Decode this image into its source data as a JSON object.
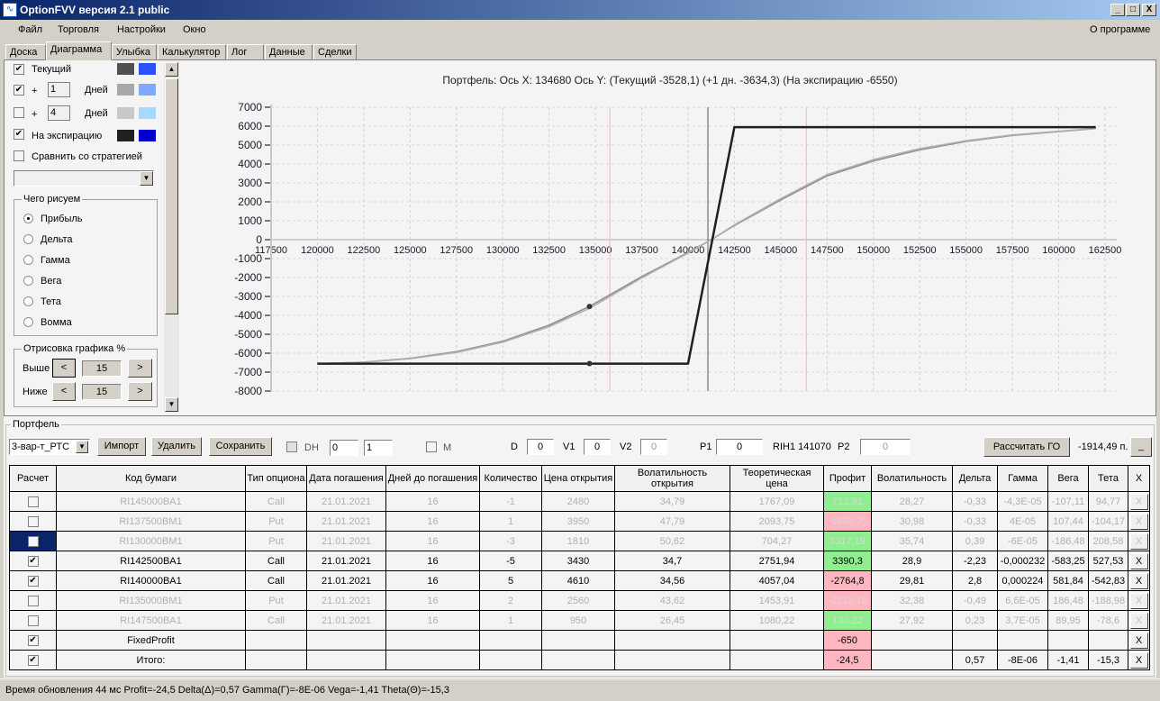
{
  "window": {
    "title": "OptionFVV версия 2.1 public",
    "minimize": "_",
    "maximize": "□",
    "close": "X"
  },
  "menu": {
    "items": [
      "Файл",
      "Торговля",
      "Настройки",
      "Окно"
    ],
    "about": "О программе"
  },
  "tabs": [
    "Доска",
    "Диаграмма",
    "Улыбка",
    "Калькулятор",
    "Лог",
    "Данные",
    "Сделки"
  ],
  "active_tab": "Диаграмма",
  "left_panel": {
    "current": {
      "label": "Текущий",
      "checked": true,
      "color1": "#505050",
      "color2": "#2a50ff"
    },
    "plus1": {
      "plus": "+",
      "days": "1",
      "label": "Дней",
      "checked": true,
      "color1": "#a8a8a8",
      "color2": "#80a8ff"
    },
    "plus4": {
      "plus": "+",
      "days": "4",
      "label": "Дней",
      "checked": false,
      "color1": "#c8c8c8",
      "color2": "#a8d8ff"
    },
    "expiration": {
      "label": "На экспирацию",
      "checked": true,
      "color1": "#202020",
      "color2": "#0000c8"
    },
    "compare": {
      "label": "Сравнить со стратегией",
      "checked": false
    },
    "compare_select": "",
    "draw_group": {
      "title": "Чего рисуем",
      "options": [
        "Прибыль",
        "Дельта",
        "Гамма",
        "Вега",
        "Тета",
        "Вомма"
      ],
      "selected": "Прибыль"
    },
    "range_group": {
      "title": "Отрисовка графика %",
      "above_label": "Выше",
      "above_value": "15",
      "below_label": "Ниже",
      "below_value": "15",
      "dec": "<",
      "inc": ">"
    }
  },
  "chart_header": "Портфель: Ось X: 134680 Ось Y:  (Текущий -3528,1)  (+1 дн. -3634,3)  (На экспирацию -6550)",
  "chart_data": {
    "type": "line",
    "title": "Портфель: Ось X: 134680 Ось Y:  (Текущий -3528,1)  (+1 дн. -3634,3)  (На экспирацию -6550)",
    "xlim": [
      117500,
      162500
    ],
    "ylim": [
      -8000,
      7000
    ],
    "xticks": [
      117500,
      120000,
      122500,
      125000,
      127500,
      130000,
      132500,
      135000,
      137500,
      140000,
      142500,
      145000,
      147500,
      150000,
      152500,
      155000,
      157500,
      160000,
      162500
    ],
    "yticks": [
      7000,
      6000,
      5000,
      4000,
      3000,
      2000,
      1000,
      0,
      -1000,
      -2000,
      -3000,
      -4000,
      -5000,
      -6000,
      -7000,
      -8000
    ],
    "grid": true,
    "series": [
      {
        "name": "Текущий",
        "color": "#909090",
        "points": [
          [
            120000,
            -6550
          ],
          [
            122500,
            -6470
          ],
          [
            125000,
            -6270
          ],
          [
            127500,
            -5920
          ],
          [
            130000,
            -5365
          ],
          [
            132500,
            -4520
          ],
          [
            134680,
            -3528
          ],
          [
            137500,
            -1950
          ],
          [
            140000,
            -680
          ],
          [
            141250,
            0
          ],
          [
            142500,
            750
          ],
          [
            145000,
            2100
          ],
          [
            147500,
            3370
          ],
          [
            150000,
            4160
          ],
          [
            152500,
            4750
          ],
          [
            155000,
            5190
          ],
          [
            157500,
            5510
          ],
          [
            160000,
            5710
          ],
          [
            162000,
            5870
          ]
        ]
      },
      {
        "name": "+1 дн.",
        "color": "#b0b0b0",
        "points": [
          [
            120000,
            -6550
          ],
          [
            122500,
            -6480
          ],
          [
            125000,
            -6290
          ],
          [
            127500,
            -5960
          ],
          [
            130000,
            -5420
          ],
          [
            132500,
            -4600
          ],
          [
            134680,
            -3634
          ],
          [
            137500,
            -2020
          ],
          [
            140000,
            -710
          ],
          [
            141250,
            0
          ],
          [
            142500,
            780
          ],
          [
            145000,
            2170
          ],
          [
            147500,
            3440
          ],
          [
            150000,
            4230
          ],
          [
            152500,
            4810
          ],
          [
            155000,
            5230
          ],
          [
            157500,
            5540
          ],
          [
            160000,
            5730
          ],
          [
            162000,
            5880
          ]
        ]
      },
      {
        "name": "На экспирацию",
        "color": "#202020",
        "points": [
          [
            120000,
            -6550
          ],
          [
            140000,
            -6550
          ],
          [
            142500,
            5950
          ],
          [
            162000,
            5950
          ]
        ]
      }
    ],
    "markers": [
      {
        "x": 134680,
        "y": -3528.1
      },
      {
        "x": 134680,
        "y": -6550
      }
    ],
    "cursor_x": 134680,
    "current_price": 141070,
    "reference_lines": [
      135780,
      146380
    ]
  },
  "portfolio": {
    "title": "Портфель",
    "strategy": "3-вар-т_РТС",
    "import": "Импорт",
    "delete": "Удалить",
    "save": "Сохранить",
    "dh_label": "DH",
    "dh_spin1": "0",
    "dh_spin2": "1",
    "m_label": "M",
    "d_label": "D",
    "d_value": "0",
    "v1_label": "V1",
    "v1_value": "0",
    "v2_label": "V2",
    "v2_value": "0",
    "p1_label": "P1",
    "p1_value": "0",
    "instrument": "RIH1 141070",
    "p2_label": "P2",
    "p2_value": "0",
    "calc_go": "Рассчитать ГО",
    "go_value": "-1914,49 п.",
    "go_button": "_",
    "columns": [
      "Расчет",
      "Код бумаги",
      "Тип опциона",
      "Дата погашения",
      "Дней до погашения",
      "Количество",
      "Цена открытия",
      "Волатильность открытия",
      "Теоретическая цена",
      "Профит",
      "Волатильность",
      "Дельта",
      "Гамма",
      "Вега",
      "Тета",
      "X"
    ],
    "rows": [
      {
        "checked": false,
        "enabled": false,
        "cells": [
          "RI145000BA1",
          "Call",
          "21.01.2021",
          "16",
          "-1",
          "2480",
          "34,79",
          "1767,09",
          "712,91",
          "28,27",
          "-0,33",
          "-4,3E-05",
          "-107,11",
          "94,77"
        ],
        "profit_sign": "pos"
      },
      {
        "checked": false,
        "enabled": false,
        "cells": [
          "RI137500BM1",
          "Put",
          "21.01.2021",
          "16",
          "1",
          "3950",
          "47,79",
          "2093,75",
          "-1856,25",
          "30,98",
          "-0,33",
          "4E-05",
          "107,44",
          "-104,17"
        ],
        "profit_sign": "neg"
      },
      {
        "checked": false,
        "enabled": false,
        "selected": true,
        "cells": [
          "RI130000BM1",
          "Put",
          "21.01.2021",
          "16",
          "-3",
          "1810",
          "50,62",
          "704,27",
          "3317,19",
          "35,74",
          "0,39",
          "-6E-05",
          "-186,48",
          "208,58"
        ],
        "profit_sign": "pos"
      },
      {
        "checked": true,
        "enabled": true,
        "cells": [
          "RI142500BA1",
          "Call",
          "21.01.2021",
          "16",
          "-5",
          "3430",
          "34,7",
          "2751,94",
          "3390,3",
          "28,9",
          "-2,23",
          "-0,000232",
          "-583,25",
          "527,53"
        ],
        "profit_sign": "pos"
      },
      {
        "checked": true,
        "enabled": true,
        "cells": [
          "RI140000BA1",
          "Call",
          "21.01.2021",
          "16",
          "5",
          "4610",
          "34,56",
          "4057,04",
          "-2764,8",
          "29,81",
          "2,8",
          "0,000224",
          "581,84",
          "-542,83"
        ],
        "profit_sign": "neg"
      },
      {
        "checked": false,
        "enabled": false,
        "cells": [
          "RI135000BM1",
          "Put",
          "21.01.2021",
          "16",
          "2",
          "2560",
          "43,62",
          "1453,91",
          "-2212,18",
          "32,38",
          "-0,49",
          "6,6E-05",
          "186,48",
          "-188,98"
        ],
        "profit_sign": "neg"
      },
      {
        "checked": false,
        "enabled": false,
        "cells": [
          "RI147500BA1",
          "Call",
          "21.01.2021",
          "16",
          "1",
          "950",
          "26,45",
          "1080,22",
          "130,22",
          "27,92",
          "0,23",
          "3,7E-05",
          "89,95",
          "-78,6"
        ],
        "profit_sign": "pos"
      },
      {
        "checked": true,
        "enabled": true,
        "cells": [
          "FixedProfit",
          "",
          "",
          "",
          "",
          "",
          "",
          "",
          "-650",
          "",
          "",
          "",
          "",
          ""
        ],
        "profit_sign": "neg"
      },
      {
        "checked": true,
        "enabled": true,
        "cells": [
          "Итого:",
          "",
          "",
          "",
          "",
          "",
          "",
          "",
          "-24,5",
          "",
          "0,57",
          "-8E-06",
          "-1,41",
          "-15,3"
        ],
        "profit_sign": "neg"
      }
    ],
    "remove_label": "X"
  },
  "status": "Время обновления 44 мс  Profit=-24,5 Delta(Δ)=0,57 Gamma(Γ)=-8E-06 Vega=-1,41 Theta(Θ)=-15,3"
}
